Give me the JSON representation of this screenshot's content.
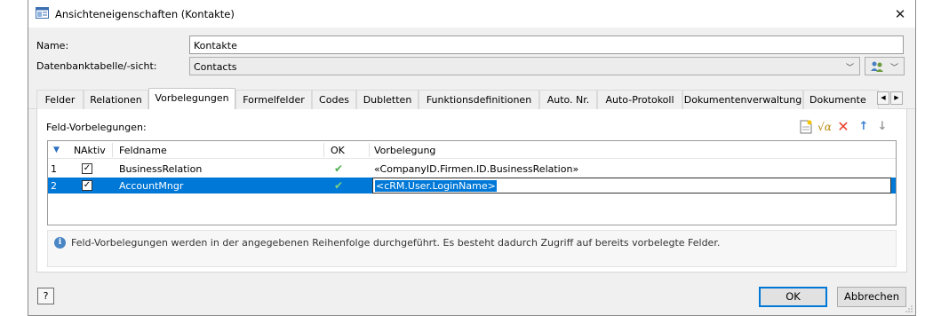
{
  "window": {
    "title": "Ansichteneigenschaften (Kontakte)",
    "close_glyph": "✕"
  },
  "form": {
    "name_label": "Name:",
    "name_value": "Kontakte",
    "table_label": "Datenbanktabelle/-sicht:",
    "table_value": "Contacts"
  },
  "tabs": [
    {
      "label": "Felder"
    },
    {
      "label": "Relationen"
    },
    {
      "label": "Vorbelegungen",
      "active": true
    },
    {
      "label": "Formelfelder"
    },
    {
      "label": "Codes"
    },
    {
      "label": "Dubletten"
    },
    {
      "label": "Funktionsdefinitionen"
    },
    {
      "label": "Auto. Nr."
    },
    {
      "label": "Auto-Protokoll"
    },
    {
      "label": "Dokumentenverwaltung"
    },
    {
      "label": "Dokumente"
    }
  ],
  "panel": {
    "title": "Feld-Vorbelegungen:",
    "grid": {
      "headers": {
        "nr": "N",
        "active": "Aktiv",
        "field": "Feldname",
        "ok": "OK",
        "default": "Vorbelegung"
      },
      "rows": [
        {
          "nr": "1",
          "active": true,
          "field": "BusinessRelation",
          "ok": "✔",
          "default": "«CompanyID.Firmen.ID.BusinessRelation»"
        },
        {
          "nr": "2",
          "active": true,
          "field": "AccountMngr",
          "ok": "✔",
          "default": "<cRM.User.LoginName>"
        }
      ]
    },
    "info": "Feld-Vorbelegungen werden in der angegebenen Reihenfolge durchgeführt. Es besteht dadurch Zugriff auf bereits vorbelegte Felder."
  },
  "buttons": {
    "help": "?",
    "ok": "OK",
    "cancel": "Abbrechen"
  },
  "colors": {
    "selection": "#0078d7",
    "check_ok": "#4caf50",
    "delete": "#e8412c",
    "arrow": "#3a7fd5"
  }
}
